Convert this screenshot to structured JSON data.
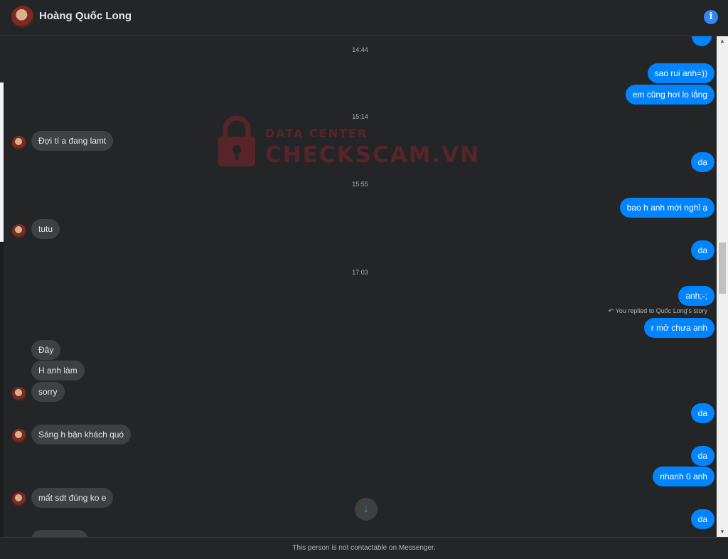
{
  "header": {
    "contact_name": "Hoàng Quốc Long",
    "info_icon": "info-icon"
  },
  "watermark": {
    "line1": "DATA CENTER",
    "line2": "CHECKSCAM.VN",
    "color": "#c0233a"
  },
  "timestamps": [
    "14:44",
    "15:14",
    "15:55",
    "17:03"
  ],
  "messages": {
    "m1": "sao rui anh=))",
    "m2": "em cũng hơi lo lắng",
    "m3": "Đợi tí a đang lamt",
    "m4": "dạ",
    "m5": "bao h anh mới nghỉ ạ",
    "m6": "tutu",
    "m7": "da",
    "m8": "anh;-;",
    "m9": "r mở chưa anh",
    "m10": "Đây",
    "m11": "H anh làm",
    "m12": "sorry",
    "m13": "da",
    "m14": "Sáng h bận khách quó",
    "m15": "da",
    "m16": "nhanh 0 anh",
    "m17": "mất sdt đúng ko e",
    "m18": "da"
  },
  "reply_note": "You replied to Quốc Long's story",
  "footer": {
    "notice": "This person is not contactable on Messenger."
  },
  "colors": {
    "outgoing": "#0084ff",
    "incoming": "#3e4042",
    "background": "#242526"
  }
}
